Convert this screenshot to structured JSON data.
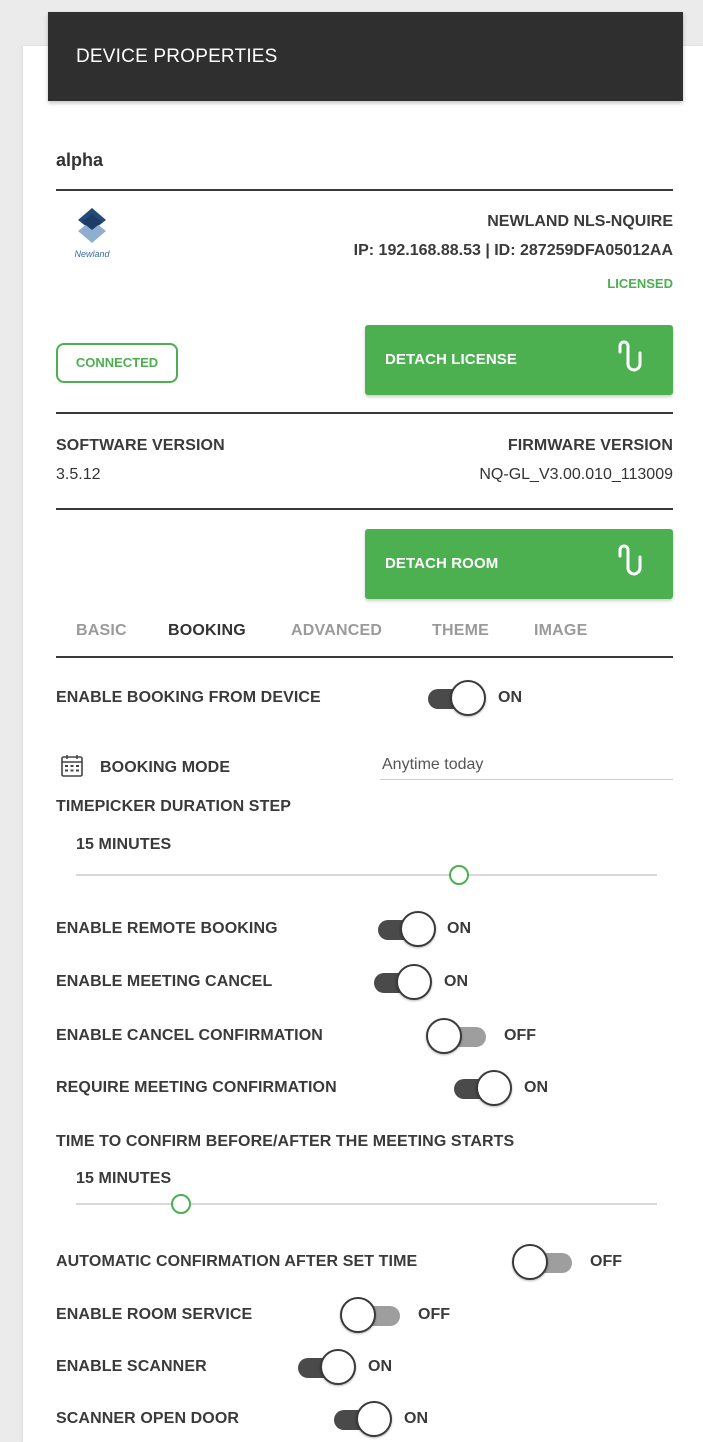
{
  "header": {
    "title": "DEVICE PROPERTIES"
  },
  "device": {
    "name": "alpha",
    "logo_text": "Newland",
    "model": "NEWLAND NLS-NQUIRE",
    "ip_id": "IP: 192.168.88.53 | ID: 287259DFA05012AA",
    "license_status": "LICENSED",
    "connection_status": "CONNECTED"
  },
  "actions": {
    "detach_license": "DETACH LICENSE",
    "detach_room": "DETACH ROOM",
    "link_icon": "unlink-icon"
  },
  "versions": {
    "software_label": "SOFTWARE VERSION",
    "software_value": "3.5.12",
    "firmware_label": "FIRMWARE VERSION",
    "firmware_value": "NQ-GL_V3.00.010_113009"
  },
  "tabs": [
    {
      "label": "BASIC",
      "active": false
    },
    {
      "label": "BOOKING",
      "active": true
    },
    {
      "label": "ADVANCED",
      "active": false
    },
    {
      "label": "THEME",
      "active": false
    },
    {
      "label": "IMAGE",
      "active": false
    }
  ],
  "booking": {
    "enable_booking_from_device": {
      "label": "ENABLE BOOKING FROM DEVICE",
      "state": "ON"
    },
    "booking_mode": {
      "label": "BOOKING MODE",
      "value": "Anytime today",
      "icon": "calendar-icon"
    },
    "timepicker_step": {
      "label": "TIMEPICKER DURATION STEP",
      "value": "15 MINUTES",
      "position": 0.66
    },
    "enable_remote_booking": {
      "label": "ENABLE REMOTE BOOKING",
      "state": "ON"
    },
    "enable_meeting_cancel": {
      "label": "ENABLE MEETING CANCEL",
      "state": "ON"
    },
    "enable_cancel_confirmation": {
      "label": "ENABLE CANCEL CONFIRMATION",
      "state": "OFF"
    },
    "require_meeting_confirmation": {
      "label": "REQUIRE MEETING CONFIRMATION",
      "state": "ON"
    },
    "time_to_confirm": {
      "label": "TIME TO CONFIRM BEFORE/AFTER THE MEETING STARTS",
      "value": "15 MINUTES",
      "position": 0.18
    },
    "automatic_confirmation": {
      "label": "AUTOMATIC CONFIRMATION AFTER SET TIME",
      "state": "OFF"
    },
    "enable_room_service": {
      "label": "ENABLE ROOM SERVICE",
      "state": "OFF"
    },
    "enable_scanner": {
      "label": "ENABLE SCANNER",
      "state": "ON"
    },
    "scanner_open_door": {
      "label": "SCANNER OPEN DOOR",
      "state": "ON"
    }
  },
  "colors": {
    "accent": "#4caf50",
    "header_bg": "#2f2f2f",
    "toggle_on": "#4a4a4a",
    "toggle_off": "#9e9e9e"
  }
}
